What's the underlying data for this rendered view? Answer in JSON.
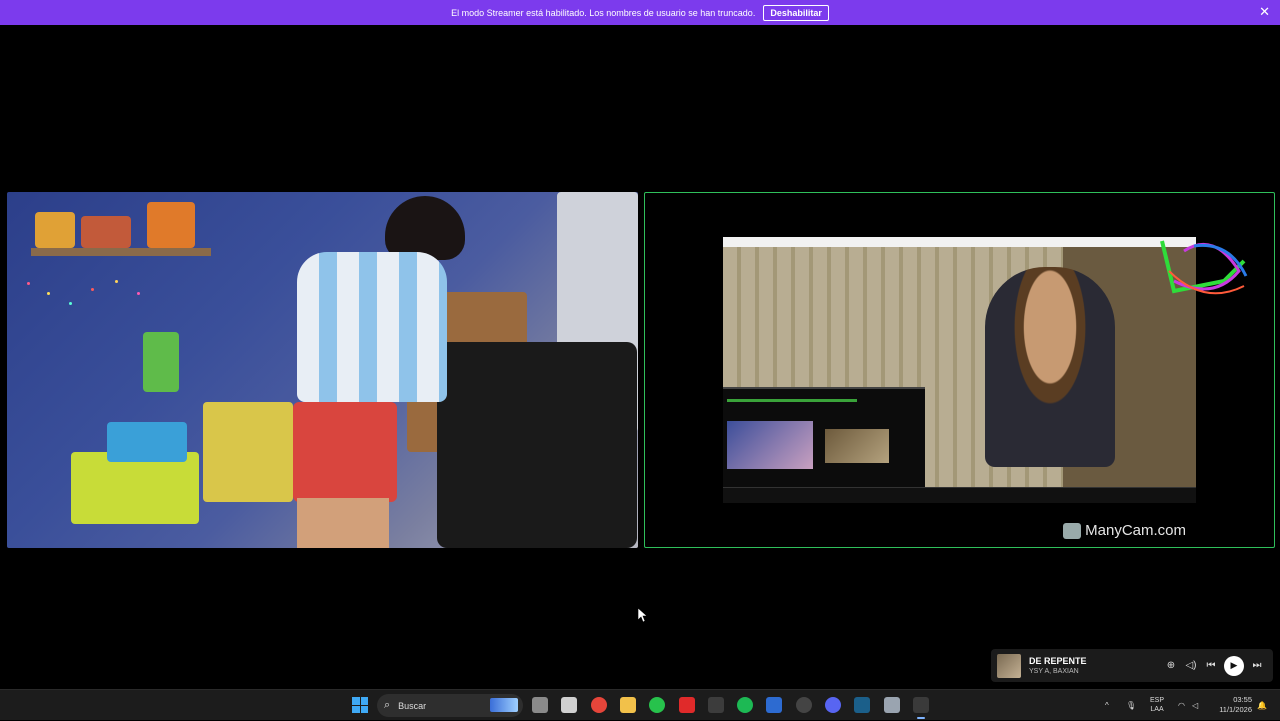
{
  "banner": {
    "message": "El modo Streamer está habilitado. Los nombres de usuario se han truncado.",
    "disable_label": "Deshabilitar",
    "close_glyph": "✕",
    "color": "#7c3bed"
  },
  "video": {
    "right_tile_border": "#2fbf5b",
    "watermark": "ManyCam.com"
  },
  "media_player": {
    "title": "DE REPENTE",
    "artist": "YSY A, BAXIAN",
    "icons": [
      "cast-icon",
      "volume-icon",
      "previous-icon",
      "play-icon",
      "next-icon"
    ],
    "glyphs": {
      "cast": "⊕",
      "volume": "◁)",
      "prev": "⏮",
      "play": "▶",
      "next": "⏭"
    }
  },
  "taskbar": {
    "search_placeholder": "Buscar",
    "search_glyph": "⌕",
    "language_top": "ESP",
    "language_bottom": "LAA",
    "time": "03:55",
    "date": "11/1/2026",
    "tray_glyphs": {
      "chevron": "^",
      "mic": "🎙",
      "wifi": "◠",
      "volume": "◁",
      "notify": "🔔"
    },
    "apps": [
      {
        "name": "task-view-icon",
        "color": "#8a8a8a"
      },
      {
        "name": "store-icon",
        "color": "#d0d0d0"
      },
      {
        "name": "chrome-icon",
        "color": "#e6453a"
      },
      {
        "name": "file-explorer-icon",
        "color": "#f2c14a"
      },
      {
        "name": "whatsapp-icon",
        "color": "#27c24c"
      },
      {
        "name": "youtube-icon",
        "color": "#e02a2a"
      },
      {
        "name": "obs-icon",
        "color": "#3c3c3c"
      },
      {
        "name": "spotify-icon",
        "color": "#1db954"
      },
      {
        "name": "app-blue-icon",
        "color": "#2d6bd1"
      },
      {
        "name": "github-icon",
        "color": "#444444"
      },
      {
        "name": "discord-icon",
        "color": "#5865f2"
      },
      {
        "name": "steam-icon",
        "color": "#1b5f8a"
      },
      {
        "name": "app-gray-icon",
        "color": "#9aa4b0"
      },
      {
        "name": "manycam-taskbar-icon",
        "color": "#3a3a3a"
      }
    ]
  }
}
